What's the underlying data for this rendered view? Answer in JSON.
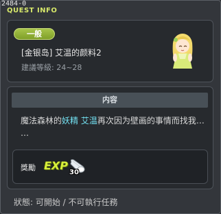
{
  "window": {
    "quest_id": "2484-0",
    "title": "QUEST INFO"
  },
  "quest": {
    "category": "一般",
    "name": "[金银岛] 艾温的颜料2",
    "level": "建議等級: 24~28"
  },
  "content": {
    "header": "内容",
    "text_prefix": "魔法森林的",
    "highlight_1": "妖精",
    "text_space": " ",
    "highlight_2": "艾温",
    "text_suffix": "再次因为壁画的事情而找我…",
    "text_cont": "…"
  },
  "reward": {
    "label": "獎勵",
    "exp_label": "EXP",
    "exp_amount": "30"
  },
  "status": {
    "text": "狀態:  可開始  / 不可執行任務"
  },
  "colors": {
    "title": "#d7e86a",
    "badge": "#8fae35",
    "highlight": "#73e1f2",
    "exp": "#d7ef3b"
  }
}
